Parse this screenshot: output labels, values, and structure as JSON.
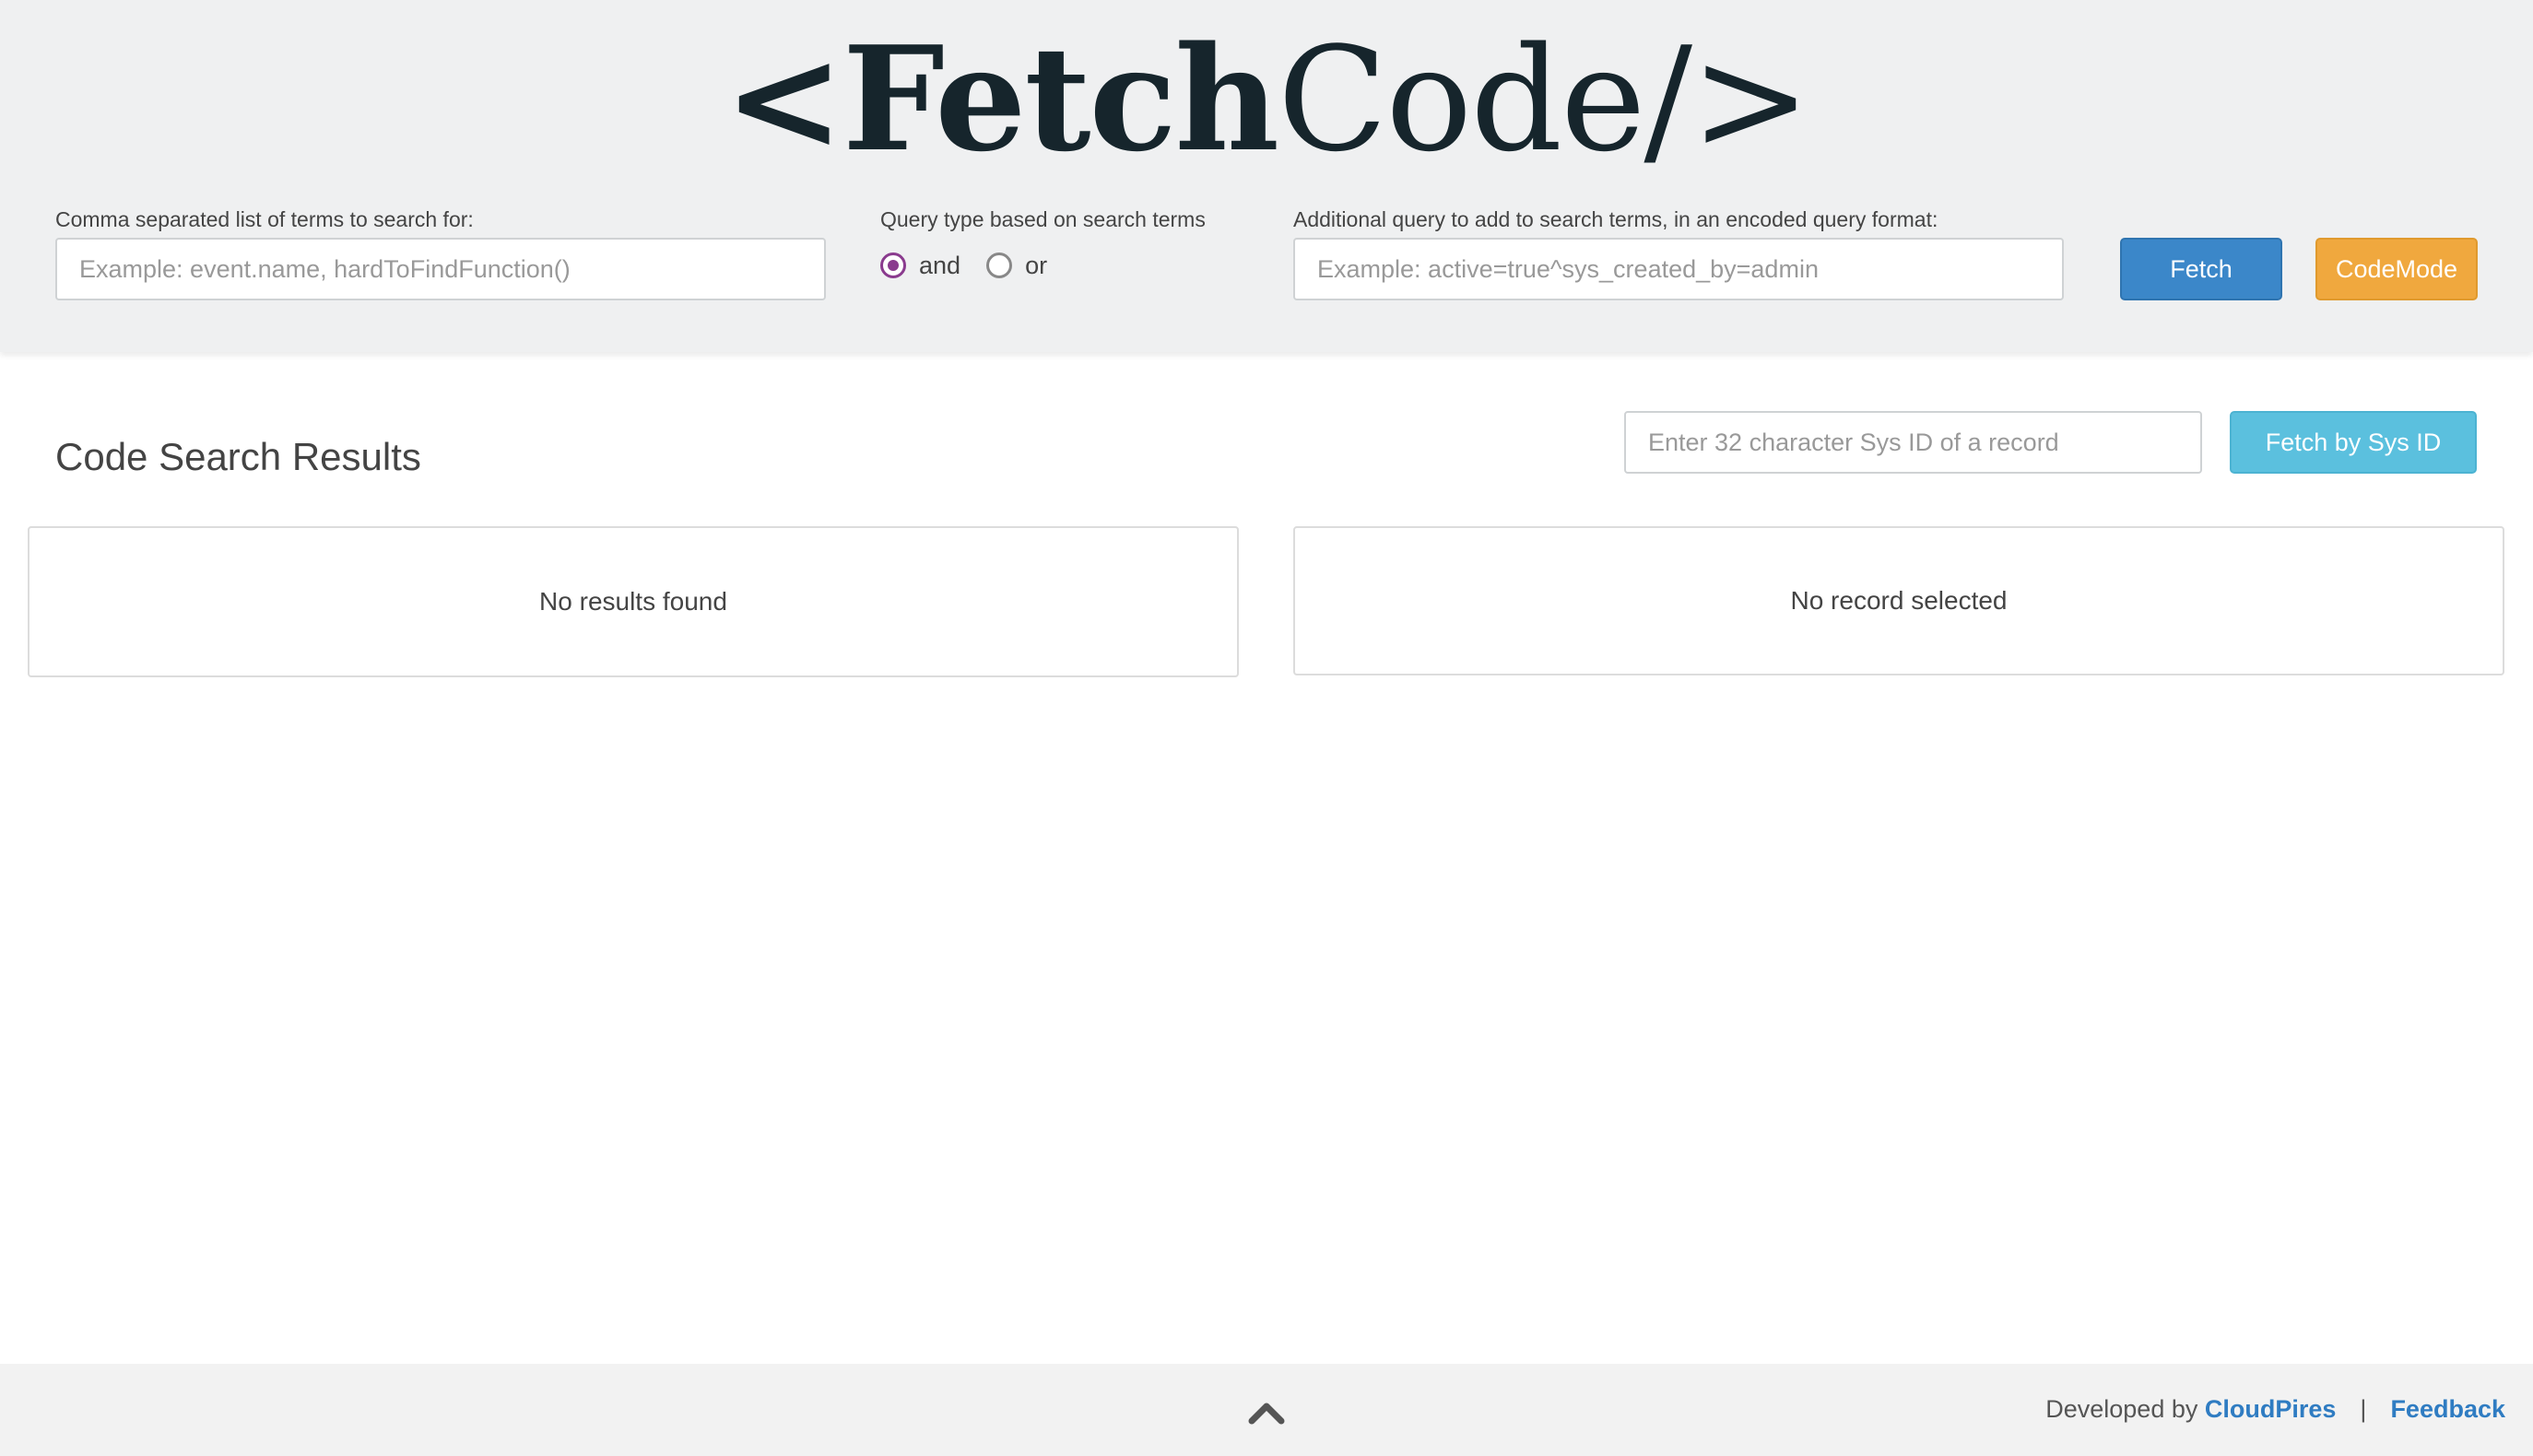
{
  "header": {
    "logo_open": "<",
    "logo_bold": "Fetch",
    "logo_light": "Code/>",
    "terms_label": "Comma separated list of terms to search for:",
    "terms_placeholder": "Example: event.name, hardToFindFunction()",
    "query_type_label": "Query type based on search terms",
    "query_options": [
      "and",
      "or"
    ],
    "query_selected": "and",
    "additional_label": "Additional query to add to search terms, in an encoded query format:",
    "additional_placeholder": "Example: active=true^sys_created_by=admin",
    "fetch_label": "Fetch",
    "codemode_label": "CodeMode"
  },
  "main": {
    "title": "Code Search Results",
    "sysid_placeholder": "Enter 32 character Sys ID of a record",
    "sysid_button": "Fetch by Sys ID",
    "results_empty": "No results found",
    "record_empty": "No record selected"
  },
  "footer": {
    "developed_by": "Developed by",
    "company": "CloudPires",
    "separator": "|",
    "feedback": "Feedback",
    "up_icon": "chevron-up-icon"
  },
  "colors": {
    "fetch_button": "#3b87c9",
    "codemode_button": "#f0a83e",
    "sysid_button": "#5bc0de",
    "radio_accent": "#8a3b8e",
    "link": "#2f7cc2"
  }
}
